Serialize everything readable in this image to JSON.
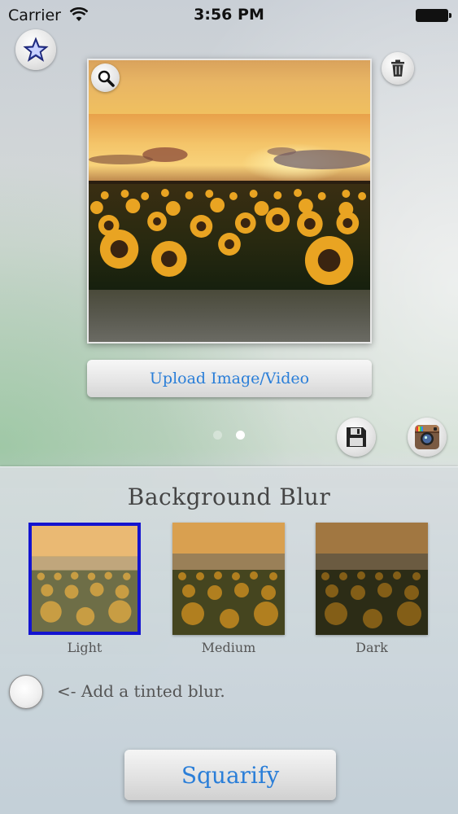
{
  "status_bar": {
    "carrier": "Carrier",
    "time": "3:56 PM"
  },
  "toolbar": {
    "favorite_icon": "star-icon",
    "delete_icon": "trash-icon",
    "zoom_icon": "magnifier-icon",
    "save_icon": "floppy-disk-icon",
    "share_icon": "instagram-icon"
  },
  "upload": {
    "label": "Upload Image/Video"
  },
  "pager": {
    "count": 2,
    "current": 2
  },
  "background_blur": {
    "title": "Background Blur",
    "options": [
      {
        "label": "Light",
        "selected": true
      },
      {
        "label": "Medium",
        "selected": false
      },
      {
        "label": "Dark",
        "selected": false
      }
    ],
    "selected_color": "#1414d0"
  },
  "tint": {
    "label": "<- Add a tinted blur.",
    "checked": false
  },
  "action": {
    "label": "Squarify"
  },
  "colors": {
    "accent": "#2a7ed8"
  }
}
